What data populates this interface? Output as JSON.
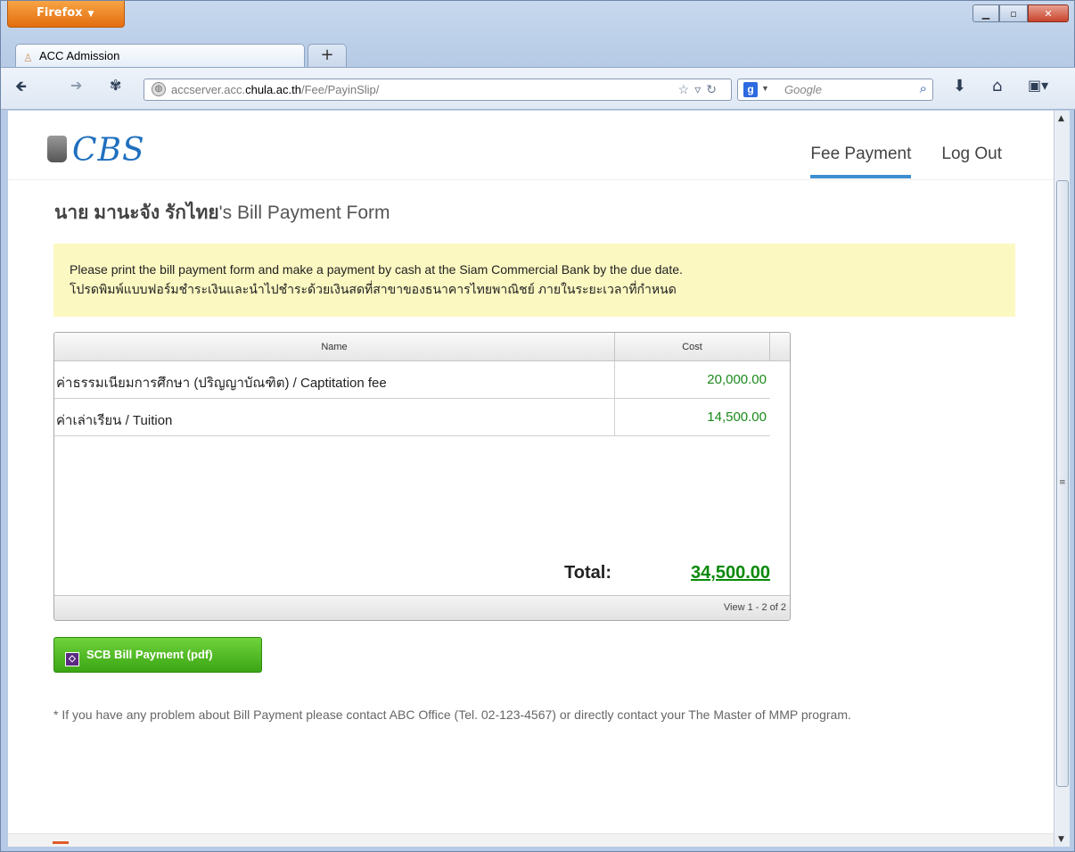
{
  "browser": {
    "menu_label": "Firefox",
    "tab_title": "ACC Admission",
    "new_tab": "+",
    "url_prefix": "accserver.acc.",
    "url_host": "chula.ac.th",
    "url_path": "/Fee/PayinSlip/",
    "search_placeholder": "Google"
  },
  "site": {
    "logo_text": "CBS",
    "nav": [
      {
        "label": "Fee Payment",
        "active": true
      },
      {
        "label": "Log Out",
        "active": false
      }
    ]
  },
  "page": {
    "owner_name": "นาย มานะจัง รักไทย",
    "title_suffix": "'s Bill Payment Form",
    "notice_en": "Please print the bill payment form and make a payment by cash at the Siam Commercial Bank by the due date.",
    "notice_th": "โปรดพิมพ์แบบฟอร์มชำระเงินและนำไปชำระด้วยเงินสดที่สาขาของธนาคารไทยพาณิชย์ ภายในระยะเวลาที่กำหนด"
  },
  "table": {
    "columns": [
      "Name",
      "Cost"
    ],
    "rows": [
      {
        "name": "ค่าธรรมเนียมการศึกษา (ปริญญาบัณฑิต) / Captitation fee",
        "cost": "20,000.00"
      },
      {
        "name": "ค่าเล่าเรียน / Tuition",
        "cost": "14,500.00"
      }
    ],
    "total_label": "Total:",
    "total_value": "34,500.00",
    "pager": "View 1 - 2 of 2"
  },
  "actions": {
    "pay_button": "SCB Bill Payment (pdf)"
  },
  "help_text": "* If you have any problem about Bill Payment please contact ABC Office (Tel. 02-123-4567) or directly contact your The Master of MMP program.",
  "colors": {
    "accent": "#3d8fd1",
    "notice_bg": "#fcf8c2",
    "money_green": "#1a8a1a",
    "button_green": "#3ba615"
  }
}
